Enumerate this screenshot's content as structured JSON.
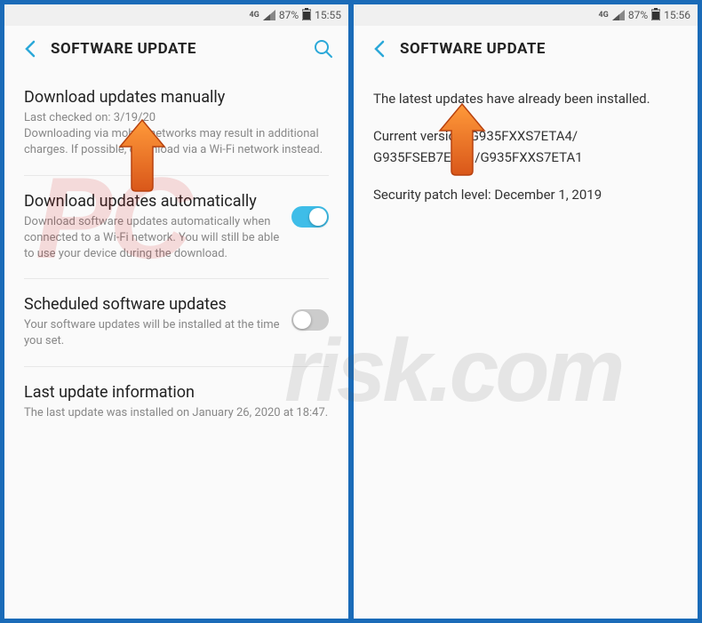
{
  "status": {
    "network": "4G",
    "battery": "87%",
    "time1": "15:55",
    "time2": "15:56"
  },
  "header": {
    "title": "SOFTWARE UPDATE"
  },
  "left": {
    "manual": {
      "title": "Download updates manually",
      "desc": "Last checked on: 3/19/20\nDownloading via mobile networks may result in additional charges. If possible, download via a Wi-Fi network instead."
    },
    "auto": {
      "title": "Download updates automatically",
      "desc": "Download software updates automatically when connected to a Wi-Fi network. You will still be able to use your device during the download."
    },
    "scheduled": {
      "title": "Scheduled software updates",
      "desc": "Your software updates will be installed at the time you set."
    },
    "lastinfo": {
      "title": "Last update information",
      "desc": "The last update was installed on January 26, 2020 at 18:47."
    }
  },
  "right": {
    "line1": "The latest updates have already been installed.",
    "line2": "Current version: G935FXXS7ETA4/ G935FSEB7ETA1/G935FXXS7ETA1",
    "line3": "Security patch level: December 1, 2019"
  },
  "watermark": {
    "pc": "PC",
    "risk": "risk.com"
  }
}
